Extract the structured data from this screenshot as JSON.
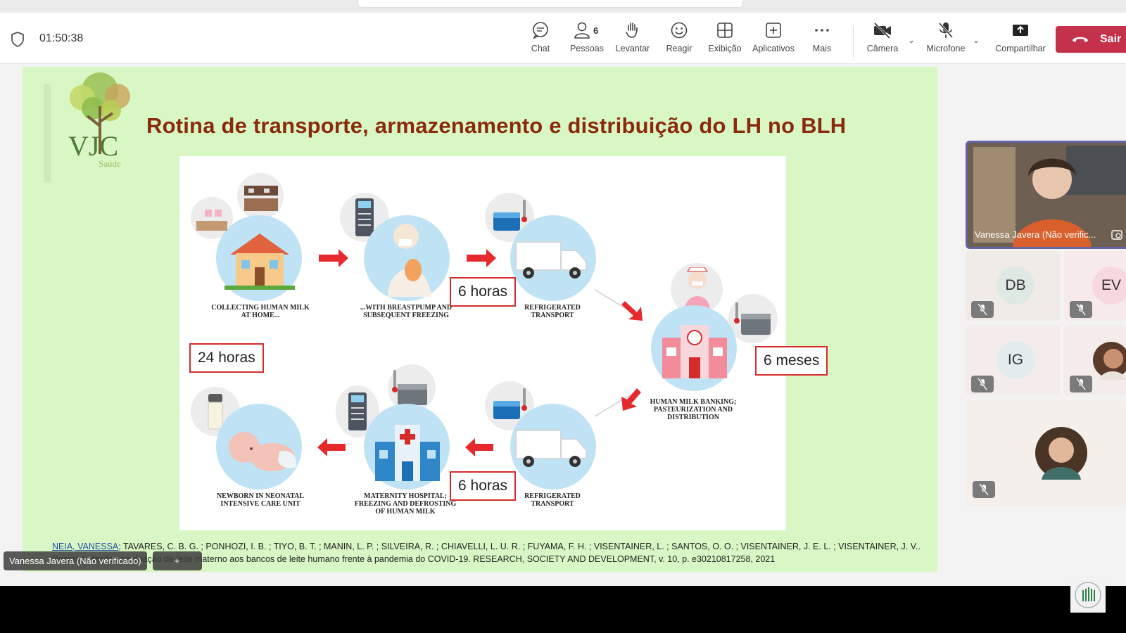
{
  "toolbar": {
    "timer": "01:50:38",
    "chat_label": "Chat",
    "people_label": "Pessoas",
    "people_count": "6",
    "raise_label": "Levantar",
    "react_label": "Reagir",
    "view_label": "Exibição",
    "apps_label": "Aplicativos",
    "more_label": "Mais",
    "camera_label": "Câmera",
    "mic_label": "Microfone",
    "share_label": "Compartilhar",
    "leave_label": "Sair",
    "leave_color": "#c4314b"
  },
  "slide": {
    "logo_text": "VJC",
    "logo_sub": "Saúde",
    "title": "Rotina de transporte, armazenamento e distribuição do LH no BLH",
    "background_color": "#d9f7c4",
    "diagram": {
      "steps": [
        {
          "caption": "COLLECTING HUMAN MILK\nAT HOME..."
        },
        {
          "caption": "...WITH BREASTPUMP AND\nSUBSEQUENT FREEZING"
        },
        {
          "caption": "REFRIGERATED\nTRANSPORT"
        },
        {
          "caption": "HUMAN MILK BANKING;\nPASTEURIZATION AND\nDISTRIBUTION"
        },
        {
          "caption": "REFRIGERATED\nTRANSPORT"
        },
        {
          "caption": "MATERNITY HOSPITAL;\nFREEZING AND DEFROSTING\nOF HUMAN MILK"
        },
        {
          "caption": "NEWBORN IN NEONATAL\nINTENSIVE CARE UNIT"
        }
      ],
      "boxes": {
        "top_transport": "6 horas",
        "storage": "6 meses",
        "bottom_transport": "6 horas",
        "newborn": "24 horas"
      }
    },
    "citation": {
      "authors_link": "NEIA, VANESSA",
      "text": "; TAVARES, C. B. G. ; PONHOZI, I. B. ; TIYO, B. T. ; MANIN, L. P. ; SILVEIRA, R. ; CHIAVELLI, L. U. R. ; FUYAMA, F. H. ; VISENTAINER, L. ; SANTOS, O. O. ; VISENTAINER, J. E. L. ; VISENTAINER, J. V..",
      "line2": "Recomendações na doação de leite materno aos bancos de leite humano frente à pandemia do COVID-19. RESEARCH, SOCIETY AND DEVELOPMENT, v. 10, p. e30210817258, 2021"
    }
  },
  "presenter_chip": "Vanessa Javera (Não verificado)",
  "participants": {
    "active_speaker": "Vanessa Javera (Não verific...",
    "tiles": [
      {
        "initials": "DB"
      },
      {
        "initials": "EV"
      },
      {
        "initials": "IG"
      }
    ]
  }
}
